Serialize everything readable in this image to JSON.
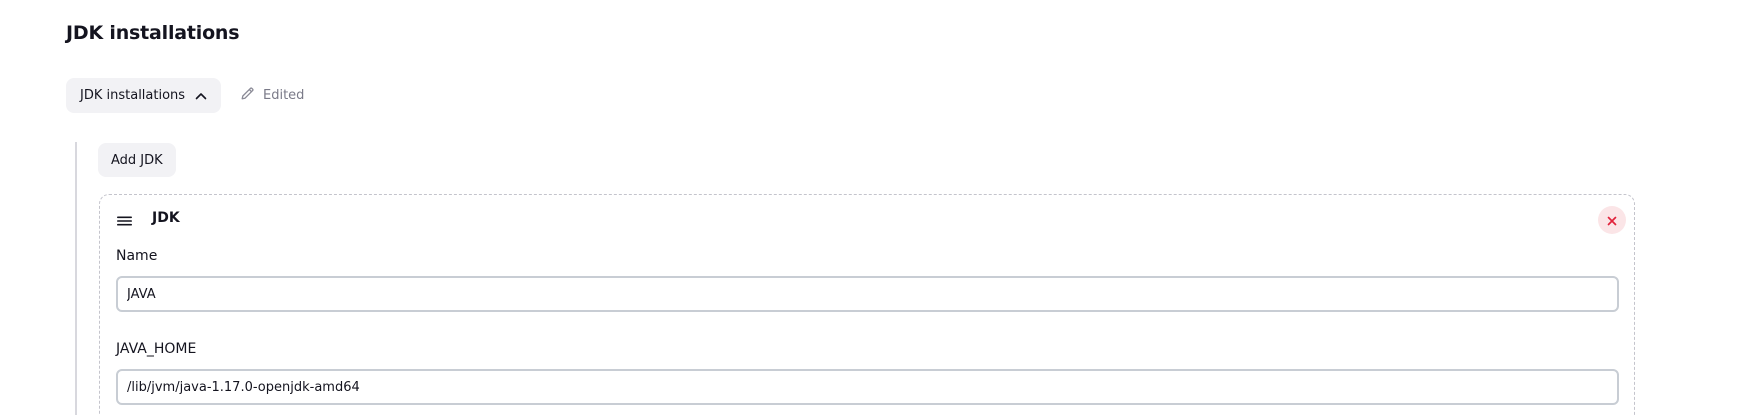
{
  "section": {
    "title": "JDK installations"
  },
  "toggle": {
    "label": "JDK installations",
    "icon": "chevron-up-icon"
  },
  "status": {
    "label": "Edited",
    "icon": "pencil-icon"
  },
  "add_button": {
    "label": "Add JDK"
  },
  "item": {
    "title": "JDK",
    "handle_icon": "drag-handle-icon",
    "delete_icon": "close-icon",
    "delete_color": "#e1223b",
    "fields": {
      "name": {
        "label": "Name",
        "value": "JAVA"
      },
      "java_home": {
        "label": "JAVA_HOME",
        "value": "/lib/jvm/java-1.17.0-openjdk-amd64"
      }
    }
  }
}
